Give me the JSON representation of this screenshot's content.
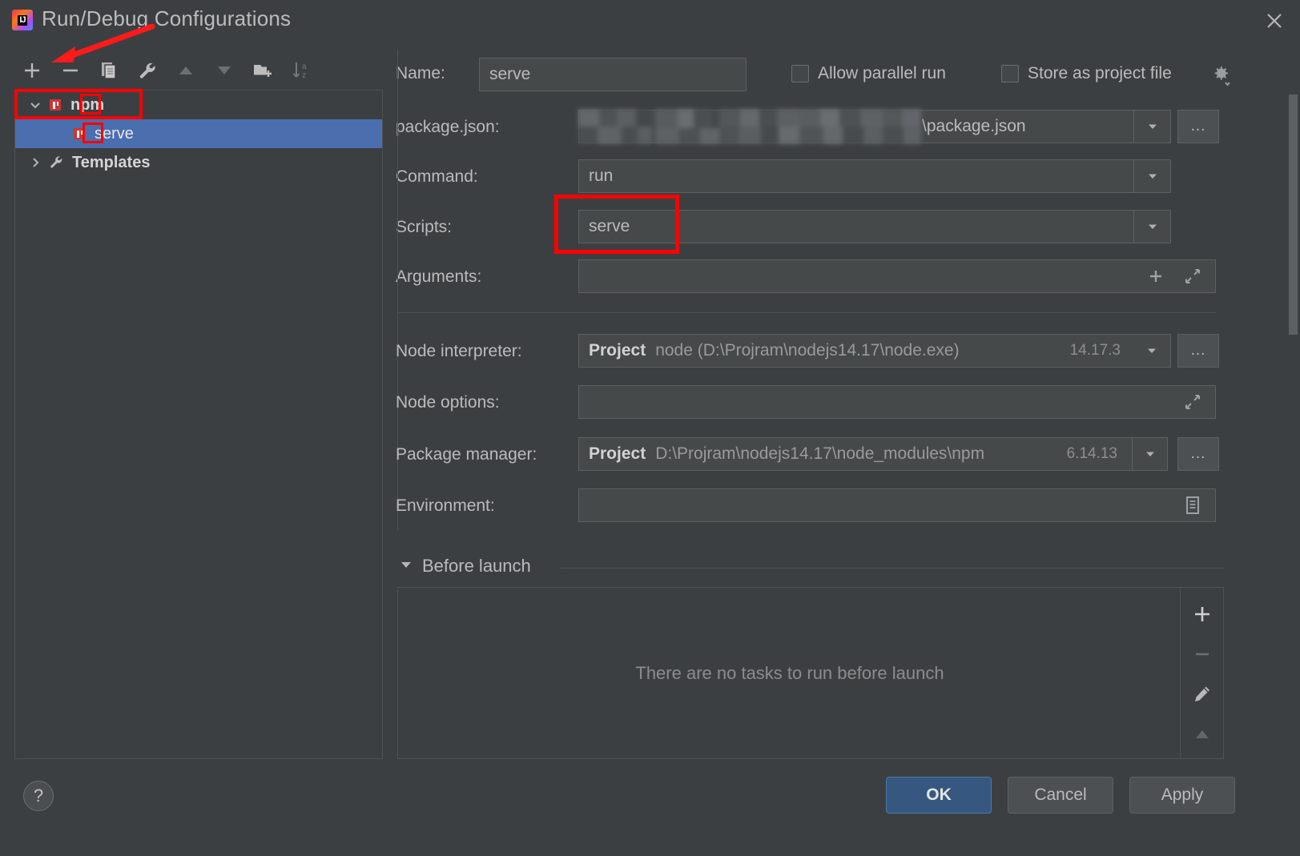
{
  "window": {
    "title": "Run/Debug Configurations",
    "logo_icon": "intellij-idea-logo",
    "logo_text": "IJ",
    "close_icon": "close-icon"
  },
  "toolbar": {
    "buttons": [
      {
        "name": "add-configuration-button",
        "icon": "plus-icon",
        "enabled": true
      },
      {
        "name": "remove-configuration-button",
        "icon": "minus-icon",
        "enabled": true
      },
      {
        "name": "copy-configuration-button",
        "icon": "copy-icon",
        "enabled": true
      },
      {
        "name": "edit-templates-button",
        "icon": "wrench-icon",
        "enabled": true
      },
      {
        "name": "move-up-button",
        "icon": "arrow-up-icon",
        "enabled": false
      },
      {
        "name": "move-down-button",
        "icon": "arrow-down-icon",
        "enabled": false
      },
      {
        "name": "new-folder-button",
        "icon": "folder-add-icon",
        "enabled": true
      },
      {
        "name": "sort-alphabetically-button",
        "icon": "sort-az-icon",
        "enabled": false
      }
    ]
  },
  "tree": {
    "nodes": [
      {
        "label": "npm",
        "icon": "npm-icon",
        "expanded": true,
        "selected": false,
        "bold": true,
        "indent": 0,
        "arrow": "chevron-down"
      },
      {
        "label": "serve",
        "icon": "npm-icon",
        "expanded": null,
        "selected": true,
        "bold": false,
        "indent": 1,
        "arrow": "none"
      },
      {
        "label": "Templates",
        "icon": "wrench-icon",
        "expanded": false,
        "selected": false,
        "bold": true,
        "indent": 0,
        "arrow": "chevron-right"
      }
    ]
  },
  "form": {
    "name": {
      "label": "Name:",
      "value": "serve"
    },
    "allow_parallel_run": {
      "label": "Allow parallel run",
      "checked": false
    },
    "store_as_project_file": {
      "label": "Store as project file",
      "checked": false
    },
    "settings_gear": {
      "icon": "gear-dropdown-icon"
    },
    "package_json": {
      "label": "package.json:",
      "value": "\\package.json",
      "value_censored_prefix": true,
      "dropdown_icon": "chevron-down-icon",
      "browse_label": "...",
      "browse_icon": "browse-ellipsis-icon"
    },
    "command": {
      "label": "Command:",
      "value": "run",
      "dropdown_icon": "chevron-down-icon"
    },
    "scripts": {
      "label": "Scripts:",
      "value": "serve",
      "dropdown_icon": "chevron-down-icon",
      "highlighted": true
    },
    "arguments": {
      "label": "Arguments:",
      "value": "",
      "add_icon": "plus-icon",
      "expand_icon": "expand-diagonal-icon"
    },
    "node_interpreter": {
      "label": "Node interpreter:",
      "scope": "Project",
      "value": "node (D:\\Projram\\nodejs14.17\\node.exe)",
      "version": "14.17.3",
      "dropdown_icon": "chevron-down-icon",
      "browse_label": "...",
      "browse_icon": "browse-ellipsis-icon"
    },
    "node_options": {
      "label": "Node options:",
      "value": "",
      "expand_icon": "expand-diagonal-icon"
    },
    "package_manager": {
      "label": "Package manager:",
      "scope": "Project",
      "value": "D:\\Projram\\nodejs14.17\\node_modules\\npm",
      "version": "6.14.13",
      "dropdown_icon": "chevron-down-icon",
      "browse_label": "...",
      "browse_icon": "browse-ellipsis-icon"
    },
    "environment": {
      "label": "Environment:",
      "value": "",
      "browse_icon": "environment-list-icon"
    }
  },
  "before_launch": {
    "title": "Before launch",
    "collapse_icon": "triangle-down-icon",
    "expanded": true,
    "empty_text": "There are no tasks to run before launch",
    "actions": [
      {
        "name": "add-task-button",
        "icon": "plus-icon",
        "enabled": true
      },
      {
        "name": "remove-task-button",
        "icon": "minus-icon",
        "enabled": false
      },
      {
        "name": "edit-task-button",
        "icon": "pencil-icon",
        "enabled": true
      },
      {
        "name": "move-task-up-button",
        "icon": "arrow-up-icon",
        "enabled": false
      }
    ]
  },
  "footer": {
    "help_label": "?",
    "help_icon": "help-question-icon",
    "ok_label": "OK",
    "cancel_label": "Cancel",
    "apply_label": "Apply"
  },
  "colors": {
    "background": "#3c3f41",
    "field_background": "#45494a",
    "selection_blue": "#4b6eaf",
    "accent_button": "#365880",
    "annotation_red": "#ff0000",
    "npm_red": "#cc3534",
    "text": "#bbbbbb",
    "muted_text": "#8c8c8c"
  }
}
